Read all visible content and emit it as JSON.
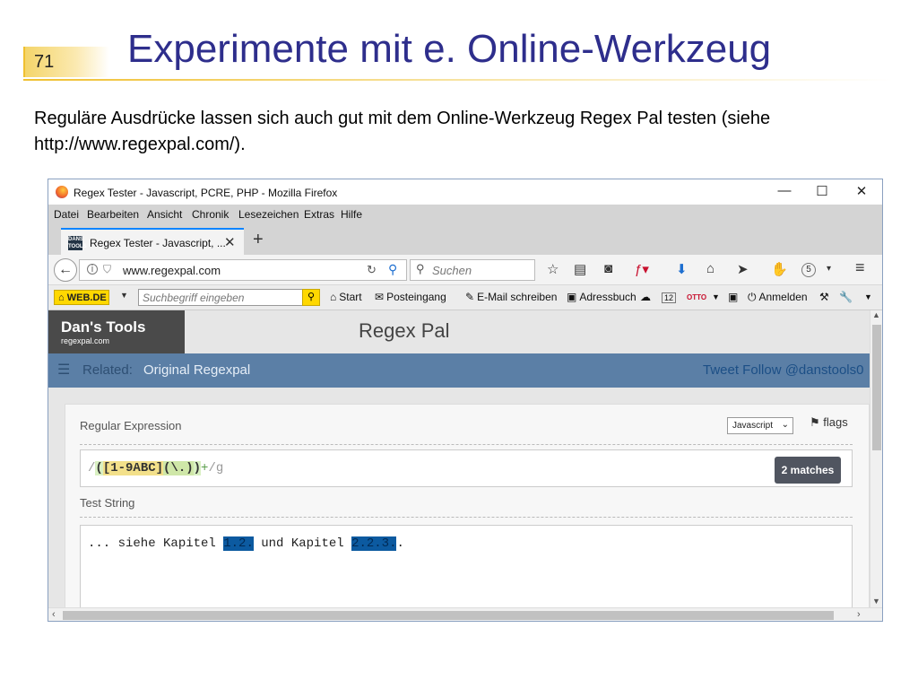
{
  "slide": {
    "number": "71",
    "title": "Experimente mit e. Online-Werkzeug",
    "intro": "Reguläre Ausdrücke lassen sich auch gut mit dem Online-Werkzeug Regex Pal testen (siehe http://www.regexpal.com/)."
  },
  "browser": {
    "window_title": "Regex Tester - Javascript, PCRE, PHP - Mozilla Firefox",
    "window_controls": {
      "minimize": "—",
      "maximize": "☐",
      "close": "✕"
    },
    "menu": [
      "Datei",
      "Bearbeiten",
      "Ansicht",
      "Chronik",
      "Lesezeichen",
      "Extras",
      "Hilfe"
    ],
    "tab": {
      "label": "Regex Tester - Javascript, ...",
      "favicon_text": "DANS TOOLS"
    },
    "url": "www.regexpal.com",
    "search_placeholder": "Suchen",
    "badge_count": "5",
    "webde": {
      "logo": "WEB.DE",
      "search_placeholder": "Suchbegriff eingeben",
      "start": "Start",
      "inbox": "Posteingang",
      "compose": "E-Mail schreiben",
      "addressbook": "Adressbuch",
      "calendar_day": "12",
      "otto": "OTTO",
      "login": "Anmelden"
    }
  },
  "site": {
    "logo_name": "Dan's Tools",
    "logo_domain": "regexpal.com",
    "header_title": "Regex Pal",
    "nav_related": "Related:",
    "nav_link": "Original Regexpal",
    "nav_tweet": "Tweet Follow @danstools0",
    "regex_label": "Regular Expression",
    "flavor": "Javascript",
    "flags": "flags",
    "regex": {
      "open_delim": "/",
      "group_open": "(",
      "char_class": "[1-9ABC]",
      "group2": "(\\.)",
      "group_close": ")",
      "quantifier": "+",
      "close_delim": "/g"
    },
    "matches": "2 matches",
    "test_label": "Test String",
    "test_string": {
      "before": "... siehe Kapitel ",
      "match1": "1.2.",
      "middle": " und Kapitel ",
      "match2": "2.2.3.",
      "after": "."
    }
  }
}
